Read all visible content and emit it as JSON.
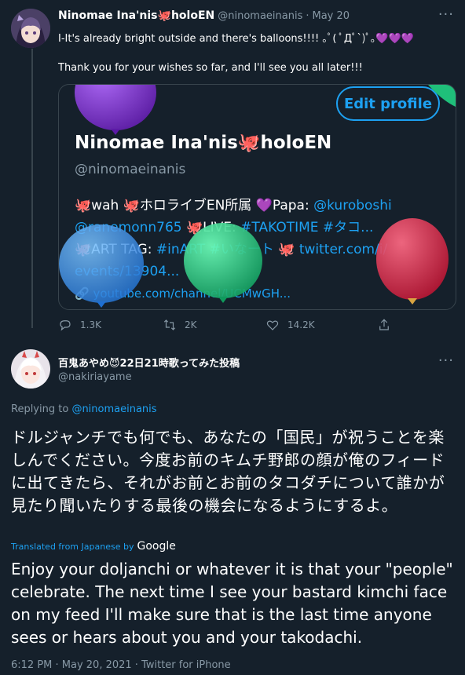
{
  "tweet1": {
    "display_name": "Ninomae Ina'nis🐙holoEN",
    "handle": "@ninomaeinanis",
    "date": "May 20",
    "text_line1": "I-It's already bright outside and there's balloons!!!! ｡ﾟ( ﾟДﾟ`)ﾟ｡💜💜💜",
    "text_line2": "Thank you for your wishes so far, and I'll see you all later!!!",
    "card": {
      "edit_profile": "Edit profile",
      "profile_name": "Ninomae Ina'nis🐙holoEN",
      "profile_handle": "@ninomaeinanis",
      "bio_line1_a": "🐙wah 🐙ホロライブEN所属 💜Papa: ",
      "bio_line1_link": "@kuroboshi",
      "bio_line2_link1": "@ranemonn765",
      "bio_line2_b": " 🐙LIVE: ",
      "bio_line2_link2": "#TAKOTIME #タコ...",
      "bio_line3_a": "🐙ART TAG: ",
      "bio_line3_link1": "#inART #いなート",
      "bio_line3_b": " 🐙 ",
      "bio_line3_link2": "twitter.com/i/",
      "bio_line4_link": "events/13904...",
      "bio_line5_link": "🔗 youtube.com/channel/UCMwGH..."
    },
    "actions": {
      "replies": "1.3K",
      "retweets": "2K",
      "likes": "14.2K"
    }
  },
  "tweet2": {
    "display_name": "百鬼あやめ😈22日21時歌ってみた投稿",
    "handle": "@nakiriayame",
    "replying_prefix": "Replying to ",
    "replying_handle": "@ninomaeinanis",
    "jp_text": "ドルジャンチでも何でも、あなたの「国民」が祝うことを楽しんでください。今度お前のキムチ野郎の顔が俺のフィードに出てきたら、それがお前とお前のタコダチについて誰かが見たり聞いたりする最後の機会になるようにするよ。",
    "translated_by": "Translated from Japanese by",
    "google": "Google",
    "en_text": "Enjoy your doljanchi or whatever it is that your \"people\" celebrate. The next time I see your bastard kimchi face on my feed I'll make sure that is the last time anyone sees or hears about you and your takodachi.",
    "meta": "6:12 PM · May 20, 2021 · Twitter for iPhone"
  },
  "colors": {
    "background": "#15202b",
    "accent": "#1da1f2",
    "muted": "#8899a6",
    "border": "#38444d"
  },
  "icons": [
    "more-icon",
    "reply-icon",
    "retweet-icon",
    "like-icon",
    "share-icon"
  ]
}
